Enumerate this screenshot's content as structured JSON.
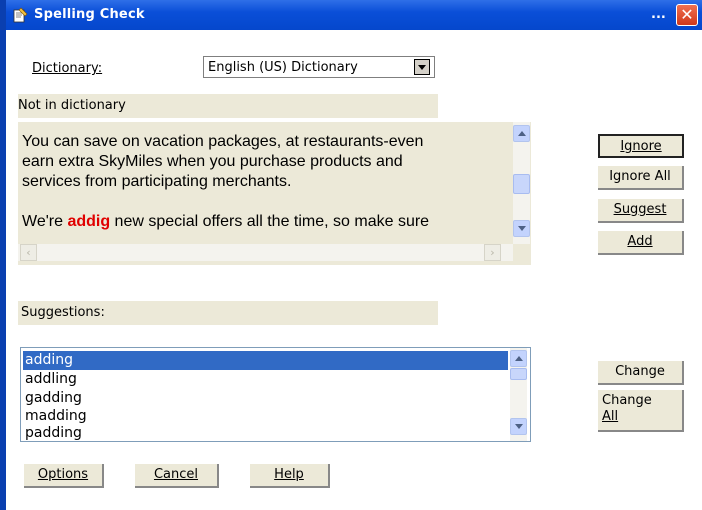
{
  "window": {
    "title": "Spelling Check",
    "title_dots": "...",
    "close_glyph": "✕"
  },
  "dictionary": {
    "label": "Dictionary:",
    "value": "English (US) Dictionary"
  },
  "not_in_dictionary": {
    "label": "Not in dictionary",
    "line1": " You can save on vacation packages, at restaurants-even",
    "line2": "earn extra SkyMiles when you purchase products and",
    "line3": "services from participating merchants.",
    "line5_before": "We're ",
    "misspelled_word": "addig",
    "line5_after": " new special offers all the time, so make sure"
  },
  "right_buttons": {
    "ignore": "Ignore",
    "ignore_all": "Ignore All",
    "suggest": "Suggest",
    "add": "Add"
  },
  "suggestions": {
    "label": "Suggestions:",
    "items": [
      "adding",
      "addling",
      "gadding",
      "madding",
      "padding"
    ],
    "selected": "adding"
  },
  "change_buttons": {
    "change": "Change",
    "change_all_line1": "Change",
    "change_all_line2": "All"
  },
  "bottom_buttons": {
    "options": "Options",
    "cancel": "Cancel",
    "help": "Help"
  },
  "colors": {
    "titlebar": "#0a4fd8",
    "selection": "#316ac5",
    "misspelling": "#e00000",
    "dialog_face": "#ece9d8"
  }
}
